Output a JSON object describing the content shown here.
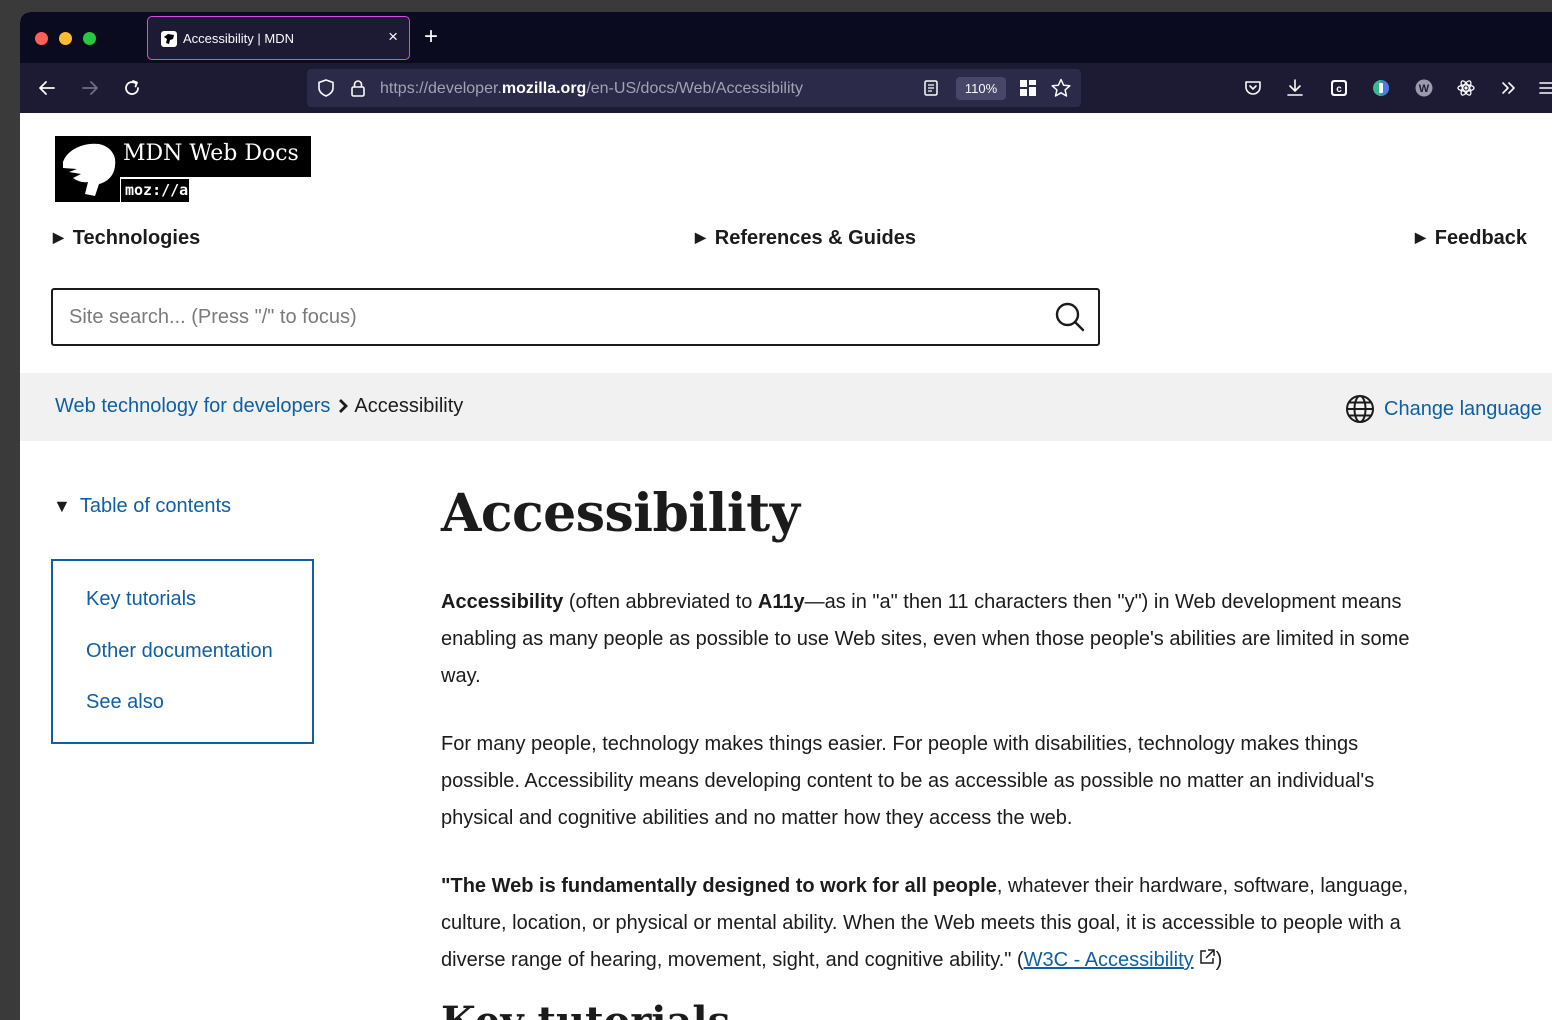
{
  "browser": {
    "tab_title": "Accessibility | MDN",
    "tab_close": "×",
    "new_tab": "+",
    "url_prefix": "https://developer.",
    "url_domain": "mozilla.org",
    "url_path": "/en-US/docs/Web/Accessibility",
    "zoom": "110%"
  },
  "header": {
    "logo_text": "MDN Web Docs",
    "logo_moz": "moz://a",
    "nav": [
      {
        "label": "Technologies"
      },
      {
        "label": "References & Guides"
      },
      {
        "label": "Feedback"
      }
    ],
    "search_placeholder": "Site search... (Press \"/\" to focus)"
  },
  "breadcrumb": {
    "parent": "Web technology for developers",
    "current": "Accessibility",
    "change_language": "Change language"
  },
  "toc": {
    "toggle_label": "Table of contents",
    "items": [
      {
        "label": "Key tutorials"
      },
      {
        "label": "Other documentation"
      },
      {
        "label": "See also"
      }
    ]
  },
  "article": {
    "title": "Accessibility",
    "p1_bold1": "Accessibility",
    "p1_text1": " (often abbreviated to ",
    "p1_bold2": "A11y",
    "p1_text2": "—as in \"a\" then 11 characters then \"y\") in Web development means enabling as many people as possible to use Web sites, even when those people's abilities are limited in some way.",
    "p2": "For many people, technology makes things easier. For people with disabilities, technology makes things possible. Accessibility means developing content to be as accessible as possible no matter an individual's physical and cognitive abilities and no matter how they access the web.",
    "p3_bold": "\"The Web is fundamentally designed to work for all people",
    "p3_text": ", whatever their hardware, software, language, culture, location, or physical or mental ability. When the Web meets this goal, it is accessible to people with a diverse range of hearing, movement, sight, and cognitive ability.\" (",
    "p3_link": "W3C - Accessibility",
    "p3_end": ")",
    "next_heading": "Key tutorials"
  }
}
